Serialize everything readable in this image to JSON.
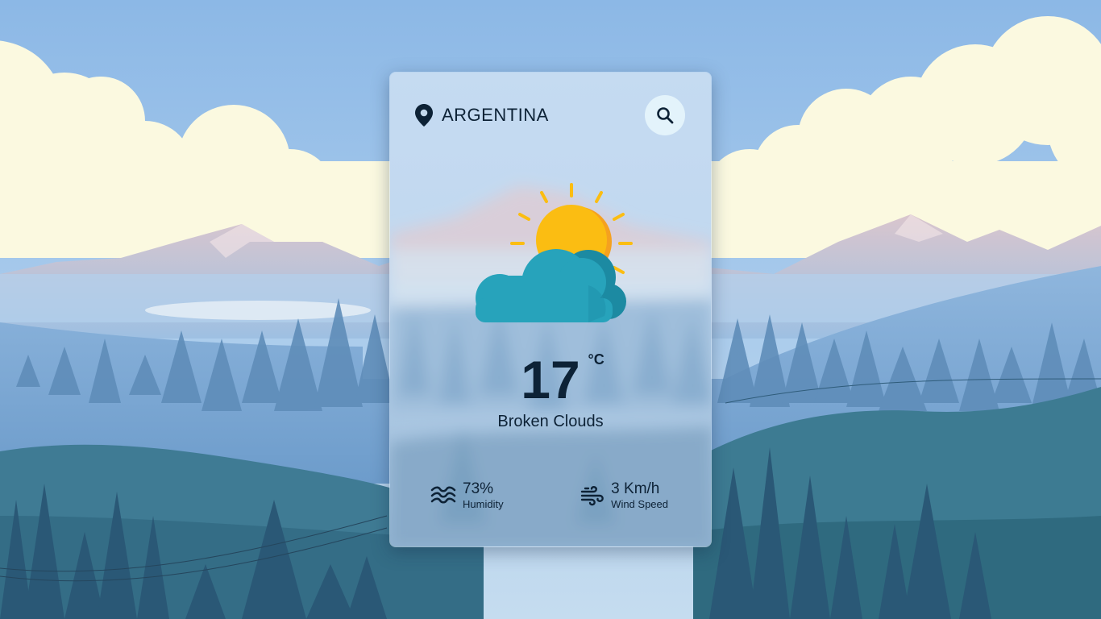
{
  "location": {
    "name": "ARGENTINA",
    "icon": "map-pin-icon"
  },
  "search": {
    "icon": "search-icon"
  },
  "weather": {
    "icon": "sun-behind-cloud-icon",
    "temperature": "17",
    "unit": "°C",
    "condition": "Broken Clouds"
  },
  "stats": {
    "humidity": {
      "value": "73%",
      "label": "Humidity",
      "icon": "waves-icon"
    },
    "wind": {
      "value": "3 Km/h",
      "label": "Wind Speed",
      "icon": "wind-icon"
    }
  },
  "colors": {
    "text": "#0d2236",
    "search_button_bg": "#e3f3fb",
    "sun": "#fbbd12",
    "sun_shade": "#f5a11f",
    "cloud": "#27a3bb",
    "cloud_shade": "#1c8aa2"
  }
}
